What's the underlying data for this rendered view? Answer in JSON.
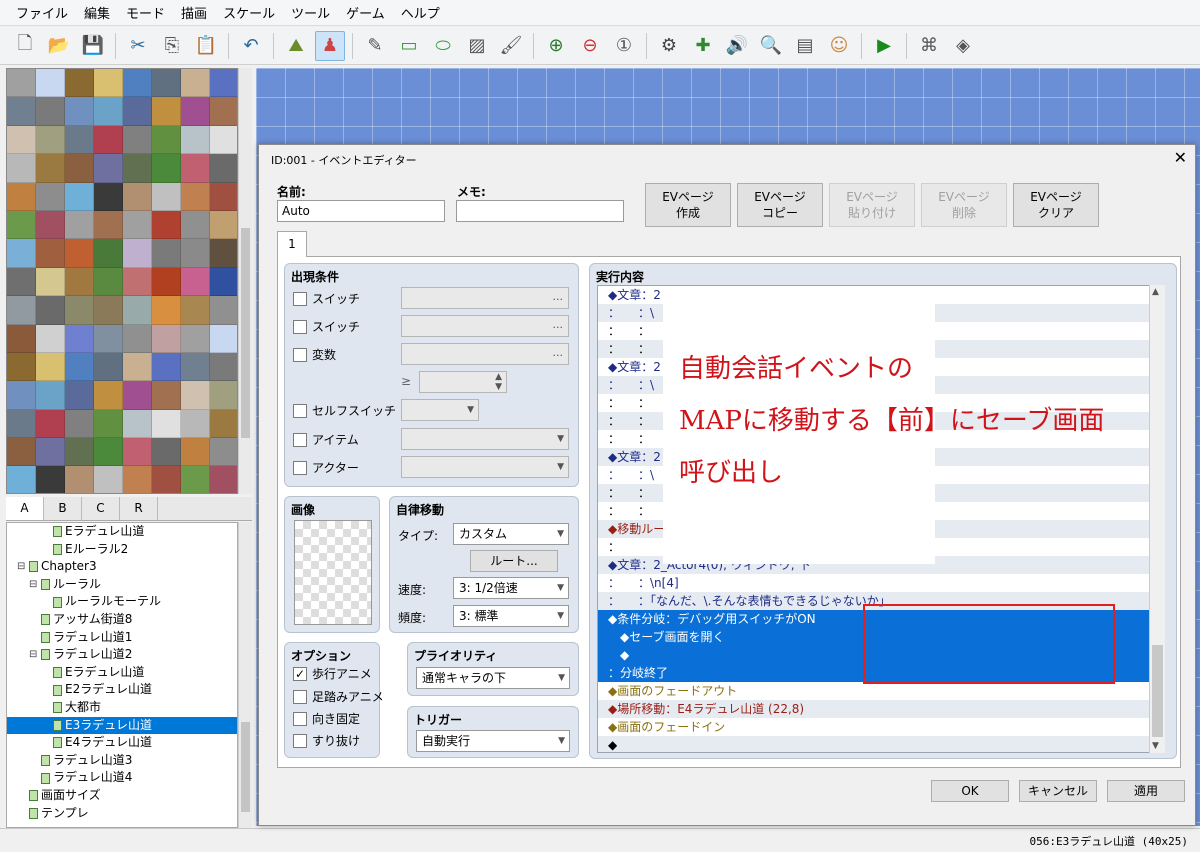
{
  "menu": [
    "ファイル",
    "編集",
    "モード",
    "描画",
    "スケール",
    "ツール",
    "ゲーム",
    "ヘルプ"
  ],
  "toolbar_icons": [
    "new-file",
    "open-folder",
    "save",
    "cut",
    "copy",
    "paste",
    "undo",
    "map-layer",
    "event-layer",
    "pencil",
    "rectangle",
    "ellipse",
    "fill",
    "brush",
    "zoom-in",
    "zoom-out",
    "zoom-1to1",
    "gear",
    "puzzle",
    "speaker",
    "search",
    "database",
    "character",
    "play",
    "script",
    "material"
  ],
  "tile_tabs": [
    "A",
    "B",
    "C",
    "R"
  ],
  "tree": [
    {
      "label": "Eラデュレ山道",
      "indent": 2,
      "exp": ""
    },
    {
      "label": "Eルーラル2",
      "indent": 2,
      "exp": ""
    },
    {
      "label": "Chapter3",
      "indent": 0,
      "exp": "⊟"
    },
    {
      "label": "ルーラル",
      "indent": 1,
      "exp": "⊟"
    },
    {
      "label": "ルーラルモーテル",
      "indent": 2,
      "exp": ""
    },
    {
      "label": "アッサム街道8",
      "indent": 1,
      "exp": ""
    },
    {
      "label": "ラデュレ山道1",
      "indent": 1,
      "exp": ""
    },
    {
      "label": "ラデュレ山道2",
      "indent": 1,
      "exp": "⊟"
    },
    {
      "label": "Eラデュレ山道",
      "indent": 2,
      "exp": ""
    },
    {
      "label": "E2ラデュレ山道",
      "indent": 2,
      "exp": ""
    },
    {
      "label": "大都市",
      "indent": 2,
      "exp": ""
    },
    {
      "label": "E3ラデュレ山道",
      "indent": 2,
      "exp": "",
      "selected": true
    },
    {
      "label": "E4ラデュレ山道",
      "indent": 2,
      "exp": ""
    },
    {
      "label": "ラデュレ山道3",
      "indent": 1,
      "exp": ""
    },
    {
      "label": "ラデュレ山道4",
      "indent": 1,
      "exp": ""
    },
    {
      "label": "画面サイズ",
      "indent": 0,
      "exp": ""
    },
    {
      "label": "テンプレ",
      "indent": 0,
      "exp": ""
    }
  ],
  "status": "056:E3ラデュレ山道 (40x25)",
  "dialog": {
    "title": "ID:001 - イベントエディター",
    "close": "✕",
    "name_label": "名前:",
    "name_value": "Auto",
    "memo_label": "メモ:",
    "memo_value": "",
    "buttons": [
      {
        "l1": "EVページ",
        "l2": "作成",
        "enabled": true
      },
      {
        "l1": "EVページ",
        "l2": "コピー",
        "enabled": true
      },
      {
        "l1": "EVページ",
        "l2": "貼り付け",
        "enabled": false
      },
      {
        "l1": "EVページ",
        "l2": "削除",
        "enabled": false
      },
      {
        "l1": "EVページ",
        "l2": "クリア",
        "enabled": true
      }
    ],
    "page_tab": "1",
    "conditions": {
      "title": "出現条件",
      "switch1": "スイッチ",
      "switch2": "スイッチ",
      "variable": "変数",
      "ge": "≥",
      "self_switch": "セルフスイッチ",
      "item": "アイテム",
      "actor": "アクター",
      "dots": "..."
    },
    "image_title": "画像",
    "autonomous": {
      "title": "自律移動",
      "type_label": "タイプ:",
      "type_value": "カスタム",
      "route": "ルート...",
      "speed_label": "速度:",
      "speed_value": "3: 1/2倍速",
      "freq_label": "頻度:",
      "freq_value": "3: 標準"
    },
    "options": {
      "title": "オプション",
      "walking": "歩行アニメ",
      "stepping": "足踏みアニメ",
      "dir_fix": "向き固定",
      "through": "すり抜け"
    },
    "priority": {
      "title": "プライオリティ",
      "value": "通常キャラの下"
    },
    "trigger": {
      "title": "トリガー",
      "value": "自動実行"
    },
    "exec_title": "実行内容",
    "exec_lines": [
      {
        "text": "◆文章：2",
        "cls": "c-nav"
      },
      {
        "text": "：　　：\\",
        "cls": "c-nav"
      },
      {
        "text": "：　　：",
        "cls": ""
      },
      {
        "text": "：　　：",
        "cls": ""
      },
      {
        "text": "◆文章：2",
        "cls": "c-nav"
      },
      {
        "text": "：　　：\\",
        "cls": "c-nav"
      },
      {
        "text": "：　　：",
        "cls": ""
      },
      {
        "text": "：　　：",
        "cls": ""
      },
      {
        "text": "：　　：",
        "cls": ""
      },
      {
        "text": "◆文章：2",
        "cls": "c-nav"
      },
      {
        "text": "：　　：\\",
        "cls": "c-nav"
      },
      {
        "text": "：　　：",
        "cls": ""
      },
      {
        "text": "：　　：",
        "cls": ""
      },
      {
        "text": "◆移動ルー",
        "cls": "c-red"
      },
      {
        "text": "：",
        "cls": ""
      },
      {
        "text": "◆文章：2_Actor4(0), ウィンドウ, 下",
        "cls": "c-nav"
      },
      {
        "text": "：　　：\\n[4]",
        "cls": "c-nav"
      },
      {
        "text": "：　　：「なんだ、\\.そんな表情もできるじゃないか」",
        "cls": "c-nav"
      },
      {
        "text": "◆条件分岐：デバッグ用スイッチがON",
        "cls": "blue"
      },
      {
        "text": "　◆セーブ画面を開く",
        "cls": "blue"
      },
      {
        "text": "　◆",
        "cls": "blue"
      },
      {
        "text": "：分岐終了",
        "cls": "blue"
      },
      {
        "text": "◆画面のフェードアウト",
        "cls": "c-ol"
      },
      {
        "text": "◆場所移動：E4ラデュレ山道 (22,8)",
        "cls": "c-red"
      },
      {
        "text": "◆画面のフェードイン",
        "cls": "c-ol"
      },
      {
        "text": "◆",
        "cls": ""
      }
    ],
    "annotation": [
      "自動会話イベントの",
      "MAPに移動する【前】にセーブ画面",
      "呼び出し"
    ],
    "ok": "OK",
    "cancel": "キャンセル",
    "apply": "適用"
  }
}
